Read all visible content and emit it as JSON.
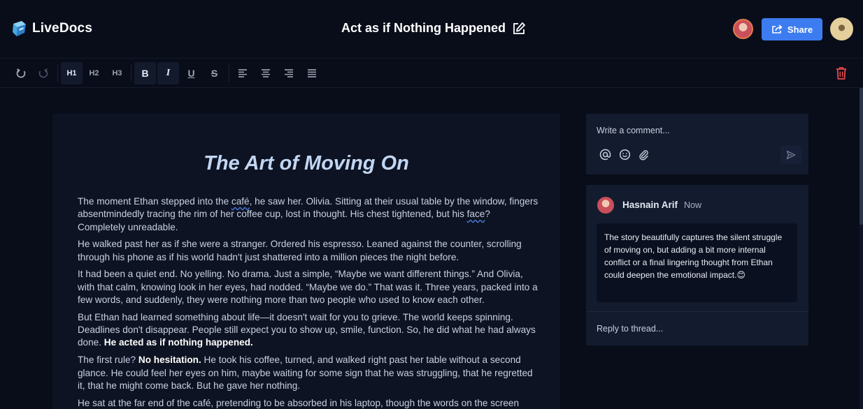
{
  "app": {
    "name": "LiveDocs"
  },
  "header": {
    "doc_title": "Act as if Nothing Happened",
    "share_label": "Share"
  },
  "toolbar": {
    "h1": "H1",
    "h2": "H2",
    "h3": "H3",
    "bold": "B",
    "italic": "I",
    "underline": "U",
    "strike": "S"
  },
  "document": {
    "heading": "The Art of Moving On",
    "paragraphs": [
      {
        "text_a": "The moment Ethan stepped into the ",
        "text_b": "café",
        "text_c": ", he saw her. Olivia. Sitting at their usual table by the window, fingers absentmindedly tracing the rim of her coffee cup, lost in thought. His chest tightened, but his ",
        "text_d": "face",
        "text_e": "? Completely unreadable."
      },
      {
        "text": "He walked past her as if she were a stranger. Ordered his espresso. Leaned against the counter, scrolling through his phone as if his world hadn't just shattered into a million pieces the night before."
      },
      {
        "text": "It had been a quiet end. No yelling. No drama. Just a simple, “Maybe we want different things.” And Olivia, with that calm, knowing look in her eyes, had nodded. “Maybe we do.” That was it. Three years, packed into a few words, and suddenly, they were nothing more than two people who used to know each other."
      },
      {
        "text": "But Ethan had learned something about life—it doesn't wait for you to grieve. The world keeps spinning. Deadlines don't disappear. People still expect you to show up, smile, function. So, he did what he had always done. ",
        "bold": "He acted as if nothing happened."
      },
      {
        "text_a": "The first rule? ",
        "bold": "No hesitation.",
        "text_b": " He took his coffee, turned, and walked right past her table without a second glance. He could feel her eyes on him, maybe waiting for some sign that he was struggling, that he regretted it, that he might come back. But he gave her nothing."
      },
      {
        "text": "He sat at the far end of the café, pretending to be absorbed in his laptop, though the words on the screen"
      }
    ]
  },
  "comments": {
    "composer_placeholder": "Write a comment...",
    "thread": {
      "author": "Hasnain Arif",
      "time": "Now",
      "body": "The story beautifully captures the silent struggle of moving on, but adding a bit more internal conflict or a final lingering thought from Ethan could deepen the emotional impact.😊",
      "reply_placeholder": "Reply to thread..."
    }
  },
  "colors": {
    "background": "#090d1a",
    "panel": "#131b2e",
    "editor": "#0d1322",
    "accent": "#3c7cf0",
    "danger": "#e5484d"
  }
}
